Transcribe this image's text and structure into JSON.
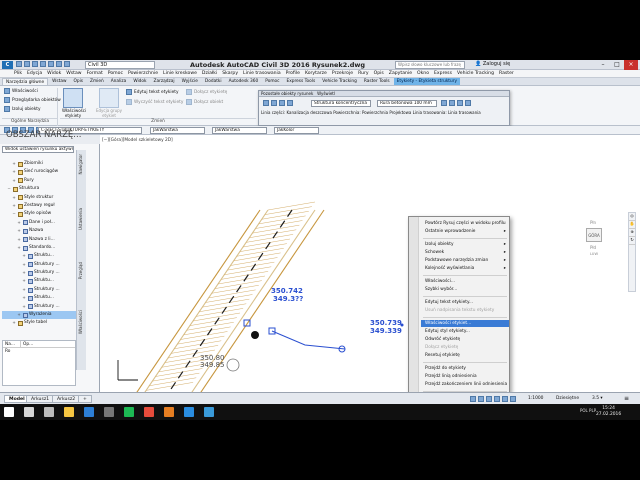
{
  "titlebar": {
    "title": "Autodesk AutoCAD Civil 3D 2016   Rysunek2.dwg",
    "workspace": "Civil 3D",
    "search_placeholder": "Wpisz słowo kluczowe lub frazę",
    "signin": "Zaloguj się"
  },
  "menubar": [
    "Plik",
    "Edycja",
    "Widok",
    "Wstaw",
    "Format",
    "Pomoc",
    "Powierzchnie",
    "Linie kreskowe",
    "Działki",
    "Skarpy",
    "Linie trasowania",
    "Profile",
    "Korytarze",
    "Przekroje",
    "Rury",
    "Opis",
    "Zapytanie",
    "Okno",
    "Express",
    "Vehicle Tracking",
    "Raster"
  ],
  "tabs": [
    {
      "label": "Narzędzia główne",
      "type": "normal"
    },
    {
      "label": "Wstaw",
      "type": "normal"
    },
    {
      "label": "Opis",
      "type": "normal"
    },
    {
      "label": "Zmień",
      "type": "normal"
    },
    {
      "label": "Analiza",
      "type": "normal"
    },
    {
      "label": "Widok",
      "type": "normal"
    },
    {
      "label": "Zarządzaj",
      "type": "normal"
    },
    {
      "label": "Wyjście",
      "type": "normal"
    },
    {
      "label": "Dodatki",
      "type": "normal"
    },
    {
      "label": "Autodesk 360",
      "type": "normal"
    },
    {
      "label": "Pomoc",
      "type": "normal"
    },
    {
      "label": "Express Tools",
      "type": "normal"
    },
    {
      "label": "Vehicle Tracking",
      "type": "normal"
    },
    {
      "label": "Raster Tools",
      "type": "normal"
    },
    {
      "label": "Etykiety - Etykieta struktury",
      "type": "ctx"
    }
  ],
  "ribbon": {
    "general": {
      "title": "Ogólne Narzędzia",
      "items": [
        "Właściwości",
        "Przeglądarka obiektów",
        "Izoluj obiekty"
      ]
    },
    "labels": {
      "big_label": "Właściwości etykiety",
      "big_label2": "Edycja grupy etykiet",
      "items": [
        "Edytuj tekst etykiety",
        "Wyczyść tekst etykiety",
        "Dołącz etykietę",
        "Dołącz obiekt",
        "Odłącz etykietę",
        "Odśwież etykietę"
      ]
    },
    "modify_title": "Zmień"
  },
  "floatbar": {
    "header": "Pozostałe obiekty rysunek",
    "header2": "Wyświetl",
    "struct_select": "Struktura koncentryczna",
    "net_select": "Rura betonowa 100 mm",
    "status": "Linia części: Kanalizacja deszczowa     Powierzchnia: Powierzchnia Projektowa  Linia trasowania: Linia trasowania"
  },
  "layerbar": {
    "layer": "C-SIECI-STRUKTURY-ETYKIETY",
    "linetype1": "JakWarstwa",
    "linetype2": "JakWarstwa",
    "lineweight": "JakKolor"
  },
  "prospector": {
    "title": "OBSZAR NARZĘ...",
    "dropdown": "Widok ustawień rysunku aktywnego",
    "tabs": [
      "Nawigator",
      "Ustawienia",
      "Przegląd",
      "Właściwości"
    ],
    "tree": [
      {
        "label": "Zbiorniki",
        "indent": 2,
        "icon": "folder"
      },
      {
        "label": "Sieć rurociągów",
        "indent": 2,
        "icon": "folder"
      },
      {
        "label": "Rury",
        "indent": 2,
        "icon": "folder"
      },
      {
        "label": "Struktura",
        "indent": 1,
        "icon": "folder",
        "exp": "−"
      },
      {
        "label": "Style struktur",
        "indent": 2,
        "icon": "folder"
      },
      {
        "label": "Zestawy reguł",
        "indent": 2,
        "icon": "folder"
      },
      {
        "label": "Style opisów",
        "indent": 2,
        "icon": "folder",
        "exp": "−"
      },
      {
        "label": "Dane i poł...",
        "indent": 3,
        "icon": "style"
      },
      {
        "label": "Nazwa",
        "indent": 3,
        "icon": "style"
      },
      {
        "label": "Nazwa z li...",
        "indent": 3,
        "icon": "style"
      },
      {
        "label": "Standardo...",
        "indent": 3,
        "icon": "style"
      },
      {
        "label": "Struktu...",
        "indent": 4,
        "icon": "style"
      },
      {
        "label": "Struktury ...",
        "indent": 4,
        "icon": "style"
      },
      {
        "label": "Struktury ...",
        "indent": 4,
        "icon": "style"
      },
      {
        "label": "Struktu...",
        "indent": 4,
        "icon": "style"
      },
      {
        "label": "Struktury ...",
        "indent": 4,
        "icon": "style"
      },
      {
        "label": "Struktu...",
        "indent": 4,
        "icon": "style"
      },
      {
        "label": "Struktury ...",
        "indent": 4,
        "icon": "style"
      },
      {
        "label": "Wyrażenia",
        "indent": 3,
        "icon": "style",
        "selected": true
      },
      {
        "label": "Style tabel",
        "indent": 2,
        "icon": "folder"
      }
    ],
    "props_header": [
      "Na...",
      "Op..."
    ],
    "props_row": [
      "Ro",
      ""
    ]
  },
  "drawing": {
    "viewport_title": "[−][Góra][Model szkieletowy 2D]",
    "labels": [
      {
        "text": "350.742",
        "color": "#2a4fd0"
      },
      {
        "text": "349.3??",
        "color": "#2a4fd0"
      },
      {
        "text": "350.739",
        "color": "#2a4fd0"
      },
      {
        "text": "349.339",
        "color": "#2a4fd0"
      },
      {
        "text": "350.80",
        "color": "#4a4a4a"
      },
      {
        "text": "349.85",
        "color": "#4a4a4a"
      }
    ],
    "navcube_face": "GÓRA",
    "navcube_n": "Płn",
    "navcube_s": "Płd",
    "navcube_w": "Zach",
    "navcube_e": "Wsch",
    "wcs": "LUW"
  },
  "contextmenu": {
    "items": [
      {
        "label": "Powtórz Rysuj części w widoku profilu",
        "state": "normal",
        "arrow": false
      },
      {
        "label": "Ostatnie wprowadzenie",
        "state": "normal",
        "arrow": true
      },
      {
        "label": "Izoluj obiekty",
        "state": "normal",
        "arrow": true
      },
      {
        "label": "Schowek",
        "state": "normal",
        "arrow": true
      },
      {
        "label": "Podstawowe narzędzia zmian",
        "state": "normal",
        "arrow": true
      },
      {
        "label": "Kolejność wyświetlania",
        "state": "normal",
        "arrow": true
      },
      {
        "label": "Właściwości...",
        "state": "normal",
        "arrow": false
      },
      {
        "label": "Szybki wybór...",
        "state": "normal",
        "arrow": false
      },
      {
        "label": "Edytuj tekst etykiety...",
        "state": "normal",
        "arrow": false
      },
      {
        "label": "Usuń nadpisania tekstu etykiety",
        "state": "disabled",
        "arrow": false
      },
      {
        "label": "Właściwości etykiet...",
        "state": "highlighted",
        "arrow": false
      },
      {
        "label": "Edytuj styl etykiety...",
        "state": "normal",
        "arrow": false
      },
      {
        "label": "Odwróć etykietę",
        "state": "normal",
        "arrow": false
      },
      {
        "label": "Dołącz etykietę",
        "state": "disabled",
        "arrow": false
      },
      {
        "label": "Resetuj etykietę",
        "state": "normal",
        "arrow": false
      },
      {
        "label": "Przejdź do etykiety",
        "state": "normal",
        "arrow": false
      },
      {
        "label": "Przejdź linią odniesienia",
        "state": "normal",
        "arrow": false
      },
      {
        "label": "Przejdź zakończeniem linii odniesienia",
        "state": "normal",
        "arrow": false
      },
      {
        "label": "Podgląd obiektów...",
        "state": "normal",
        "arrow": false
      },
      {
        "label": "Wybierz podobne",
        "state": "normal",
        "arrow": false
      }
    ]
  },
  "cmdline": {
    "placeholder": "Wpisz polecenie"
  },
  "statusbar": {
    "tabs": [
      "Model",
      "Arkusz1",
      "Arkusz2"
    ],
    "active": "Model",
    "add": "+",
    "scale": "1:1000",
    "workspace": "Dziesiętne",
    "right_text": "3.5 ▾"
  },
  "taskbar": {
    "time": "15:24",
    "date": "27.02.2016",
    "lang": "POL PLP",
    "icons": [
      "windows",
      "search",
      "task-view",
      "explorer",
      "autocad",
      "calculator",
      "spotify",
      "chrome",
      "firefox",
      "mail",
      "civil3d"
    ]
  }
}
